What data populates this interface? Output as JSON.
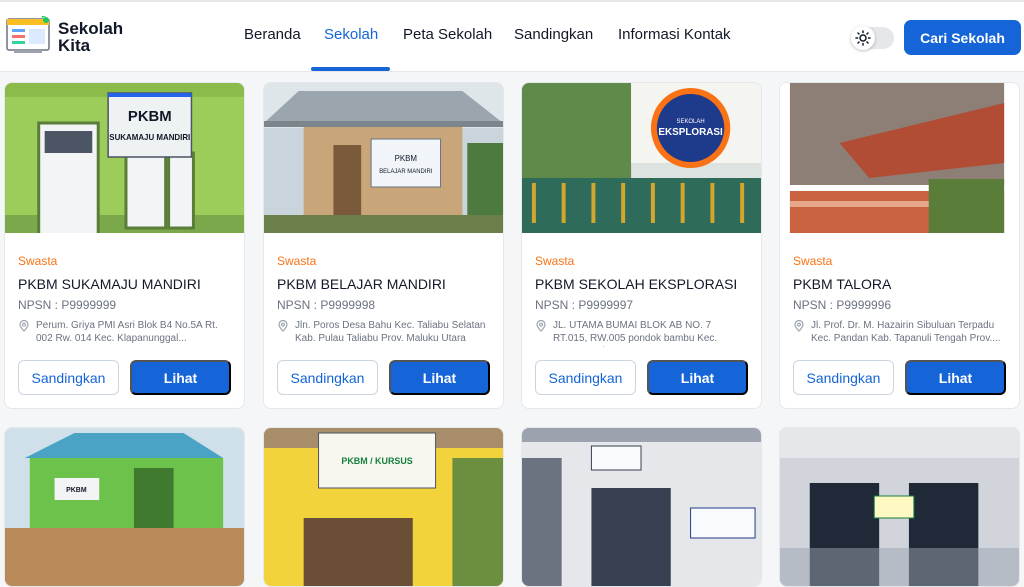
{
  "brand": {
    "name_line1": "Sekolah",
    "name_line2": "Kita",
    "logo_icon": "school-board-icon"
  },
  "nav": {
    "items": [
      "Beranda",
      "Sekolah",
      "Peta Sekolah",
      "Sandingkan",
      "Informasi Kontak"
    ],
    "active_index": 1
  },
  "theme_toggle": {
    "icon": "sun-icon",
    "state": "light"
  },
  "cta": {
    "label": "Cari Sekolah"
  },
  "colors": {
    "accent": "#1565d8",
    "status": "#f97316"
  },
  "cards": [
    {
      "status": "Swasta",
      "name": "PKBM SUKAMAJU MANDIRI",
      "npsn": "NPSN : P9999999",
      "address": "Perum. Griya PMI Asri Blok B4 No.5A Rt. 002 Rw. 014 Kec. Klapanunggal...",
      "compare_label": "Sandingkan",
      "view_label": "Lihat",
      "sign_line1": "PKBM",
      "sign_line2": "SUKAMAJU MANDIRI"
    },
    {
      "status": "Swasta",
      "name": "PKBM BELAJAR MANDIRI",
      "npsn": "NPSN : P9999998",
      "address": "Jln. Poros Desa Bahu Kec. Taliabu Selatan Kab. Pulau Taliabu Prov. Maluku Utara",
      "compare_label": "Sandingkan",
      "view_label": "Lihat",
      "sign_line1": "PKBM",
      "sign_line2": "BELAJAR MANDIRI"
    },
    {
      "status": "Swasta",
      "name": "PKBM SEKOLAH EKSPLORASI",
      "npsn": "NPSN : P9999997",
      "address": "JL. UTAMA BUMAI BLOK AB NO. 7 RT.015, RW.005 pondok bambu Kec. Duren Sawi...",
      "compare_label": "Sandingkan",
      "view_label": "Lihat",
      "sign_line1": "SEKOLAH",
      "sign_line2": "EKSPLORASI"
    },
    {
      "status": "Swasta",
      "name": "PKBM TALORA",
      "npsn": "NPSN : P9999996",
      "address": "Jl. Prof. Dr. M. Hazairin Sibuluan Terpadu Kec. Pandan Kab. Tapanuli Tengah Prov....",
      "compare_label": "Sandingkan",
      "view_label": "Lihat"
    }
  ],
  "second_row_signs": [
    "PKBM",
    "PKBM / KURSUS",
    "",
    ""
  ]
}
